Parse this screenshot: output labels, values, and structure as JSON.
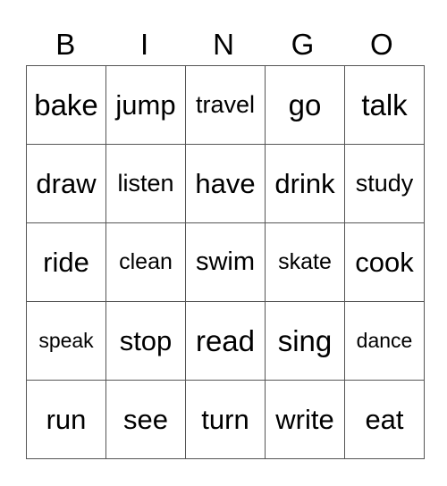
{
  "header": [
    "B",
    "I",
    "N",
    "G",
    "O"
  ],
  "rows": [
    [
      "bake",
      "jump",
      "travel",
      "go",
      "talk"
    ],
    [
      "draw",
      "listen",
      "have",
      "drink",
      "study"
    ],
    [
      "ride",
      "clean",
      "swim",
      "skate",
      "cook"
    ],
    [
      "speak",
      "stop",
      "read",
      "sing",
      "dance"
    ],
    [
      "run",
      "see",
      "turn",
      "write",
      "eat"
    ]
  ]
}
